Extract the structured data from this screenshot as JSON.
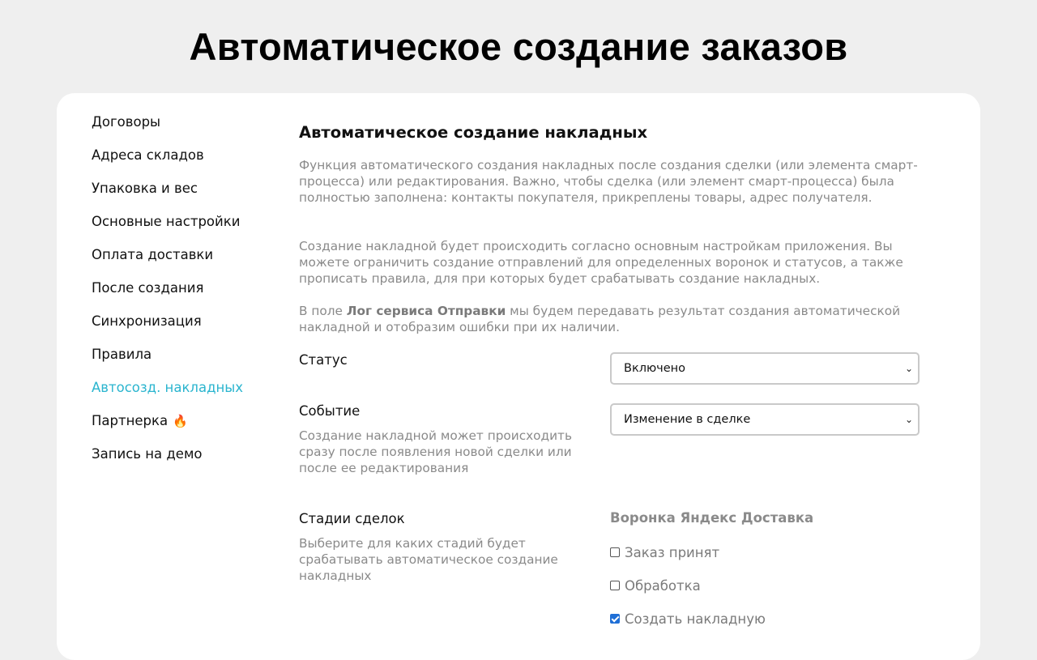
{
  "page": {
    "title": "Автоматическое создание заказов"
  },
  "sidebar": {
    "items": [
      {
        "label": "Договоры"
      },
      {
        "label": "Адреса складов"
      },
      {
        "label": "Упаковка и вес"
      },
      {
        "label": "Основные настройки"
      },
      {
        "label": "Оплата доставки"
      },
      {
        "label": "После создания"
      },
      {
        "label": "Синхронизация"
      },
      {
        "label": "Правила"
      },
      {
        "label": "Автосозд. накладных",
        "active": true
      },
      {
        "label": "Партнерка",
        "icon": "fire-icon"
      },
      {
        "label": "Запись на демо"
      }
    ]
  },
  "section": {
    "title": "Автоматическое создание накладных",
    "p1": "Функция автоматического создания накладных после создания сделки (или элемента смарт-процесса) или редактирования. Важно, чтобы сделка (или элемент смарт-процесса) была полностью заполнена: контакты покупателя, прикреплены товары, адрес получателя.",
    "p2": "Создание накладной будет происходить согласно основным настройкам приложения. Вы можете ограничить создание отправлений для определенных воронок и статусов, а также прописать правила, для при которых будет срабатывать создание накладных.",
    "p3_before": "В поле ",
    "p3_bold": "Лог сервиса Отправки",
    "p3_after": " мы будем передавать результат создания автоматической накладной и отобразим ошибки при их наличии."
  },
  "status": {
    "label": "Статус",
    "value": "Включено"
  },
  "event": {
    "label": "Событие",
    "hint": "Создание накладной может происходить сразу после появления новой сделки или после ее редактирования",
    "value": "Изменение в сделке"
  },
  "stages": {
    "label": "Стадии сделок",
    "hint": "Выберите для каких стадий будет срабатывать автоматическое создание накладных",
    "funnel_title": "Воронка Яндекс Доставка",
    "options": [
      {
        "label": "Заказ принят",
        "checked": false
      },
      {
        "label": "Обработка",
        "checked": false
      },
      {
        "label": "Создать накладную",
        "checked": true
      }
    ]
  },
  "colors": {
    "accent": "#2bb5cf",
    "background": "#efefef",
    "card": "#ffffff",
    "muted_text": "#8a8a8a",
    "checkbox": "#1f6fd6"
  },
  "icons": {
    "partner": "fire-icon",
    "select": "chevron-down-icon"
  }
}
